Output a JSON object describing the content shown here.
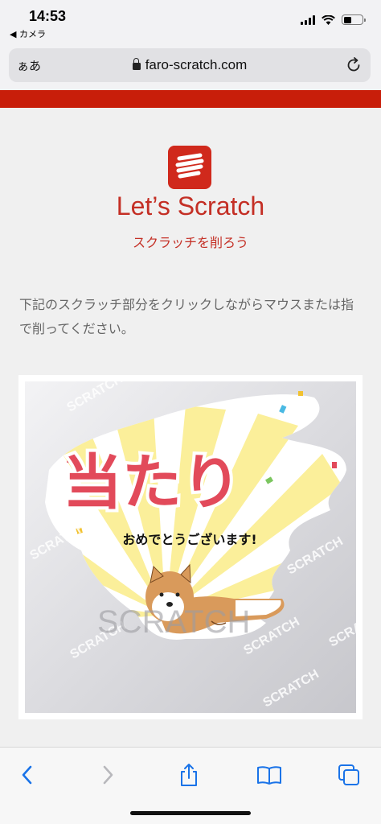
{
  "status_bar": {
    "time": "14:53",
    "back_label": "◀ カメラ",
    "battery_level": 0.45
  },
  "address_bar": {
    "text_size_label": "ぁあ",
    "url": "faro-scratch.com"
  },
  "header": {
    "title": "Let’s Scratch",
    "subtitle": "スクラッチを削ろう"
  },
  "instructions": "下記のスクラッチ部分をクリックしながらマウスまたは指で削ってください。",
  "scratch_card": {
    "result_title": "当たり",
    "message": "おめでとうございます!",
    "watermark": "SCRATCH"
  },
  "colors": {
    "brand_red": "#c81e0a",
    "text_red": "#c42f25",
    "ios_blue": "#1a73e8"
  },
  "bottom_toolbar": [
    "back-icon",
    "forward-icon",
    "share-icon",
    "bookmarks-icon",
    "tabs-icon"
  ]
}
